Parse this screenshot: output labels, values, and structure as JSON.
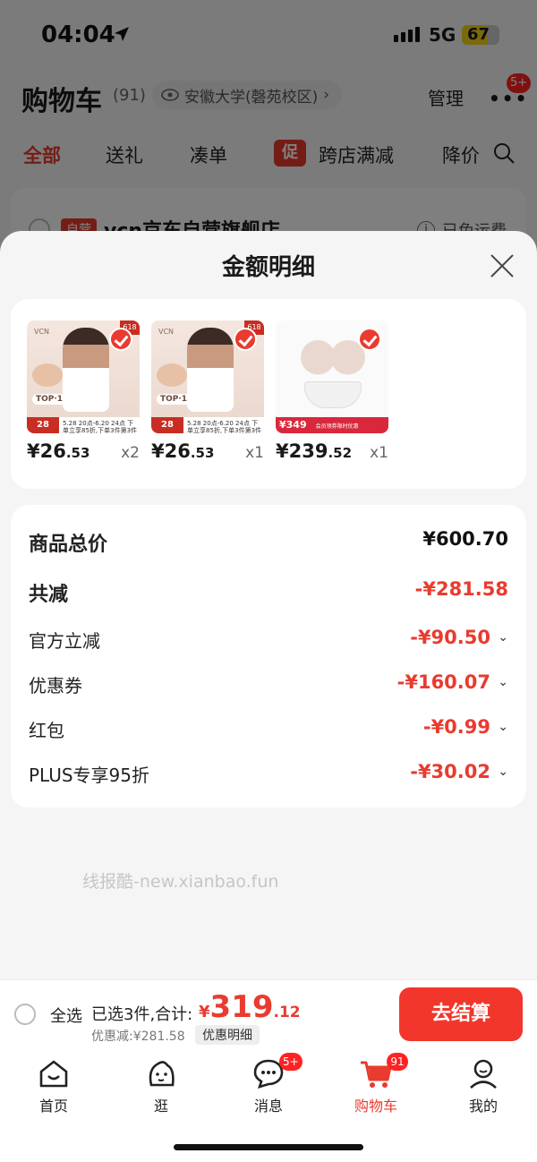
{
  "status": {
    "time": "04:04",
    "network": "5G",
    "battery": "67",
    "battery_level": 0.67
  },
  "header": {
    "title": "购物车",
    "count": "(91)",
    "location": "安徽大学(磬苑校区)",
    "manage": "管理",
    "more_badge": "5+"
  },
  "tabs": [
    "全部",
    "送礼",
    "凑单",
    "跨店满减",
    "降价"
  ],
  "promo_badge": "促",
  "store": {
    "tag": "自营",
    "name": "vcn京东自营旗舰店",
    "free_shipping": "已免运费"
  },
  "sheet": {
    "title": "金额明细",
    "products": [
      {
        "price_int": "¥26",
        "price_dec": ".53",
        "qty": "x2",
        "logo": "VCN",
        "tag": "618",
        "top": "TOP·1",
        "band": "28",
        "band_text": "5.28 20点-6.20 24点 下单立享85折,下单3件第3件0元"
      },
      {
        "price_int": "¥26",
        "price_dec": ".53",
        "qty": "x1",
        "logo": "VCN",
        "tag": "618",
        "top": "TOP·1",
        "band": "28",
        "band_text": "5.28 20点-6.20 24点 下单立享85折,下单3件第3件0元"
      },
      {
        "price_int": "¥239",
        "price_dec": ".52",
        "qty": "x1",
        "band": "¥349",
        "band_text": "会员领券限时优惠"
      }
    ],
    "summary": {
      "total_label": "商品总价",
      "total_value": "¥600.70",
      "reduce_label": "共减",
      "reduce_value": "-¥281.58",
      "items": [
        {
          "label": "官方立减",
          "value": "-¥90.50"
        },
        {
          "label": "优惠券",
          "value": "-¥160.07"
        },
        {
          "label": "红包",
          "value": "-¥0.99"
        },
        {
          "label": "PLUS专享95折",
          "value": "-¥30.02"
        }
      ]
    },
    "watermark": "线报酷-new.xianbao.fun"
  },
  "checkout": {
    "select_all": "全选",
    "selected": "已选3件,合计:",
    "currency": "¥",
    "total_int": "319",
    "total_dec": ".12",
    "discount": "优惠减:¥281.58",
    "detail": "优惠明细",
    "button": "去结算"
  },
  "nav": [
    {
      "label": "首页",
      "icon": "home-icon"
    },
    {
      "label": "逛",
      "icon": "explore-icon"
    },
    {
      "label": "消息",
      "icon": "message-icon",
      "badge": "5+"
    },
    {
      "label": "购物车",
      "icon": "cart-icon",
      "badge": "91"
    },
    {
      "label": "我的",
      "icon": "profile-icon"
    }
  ],
  "colors": {
    "accent": "#e93b2f",
    "checkout": "#f2362c"
  }
}
